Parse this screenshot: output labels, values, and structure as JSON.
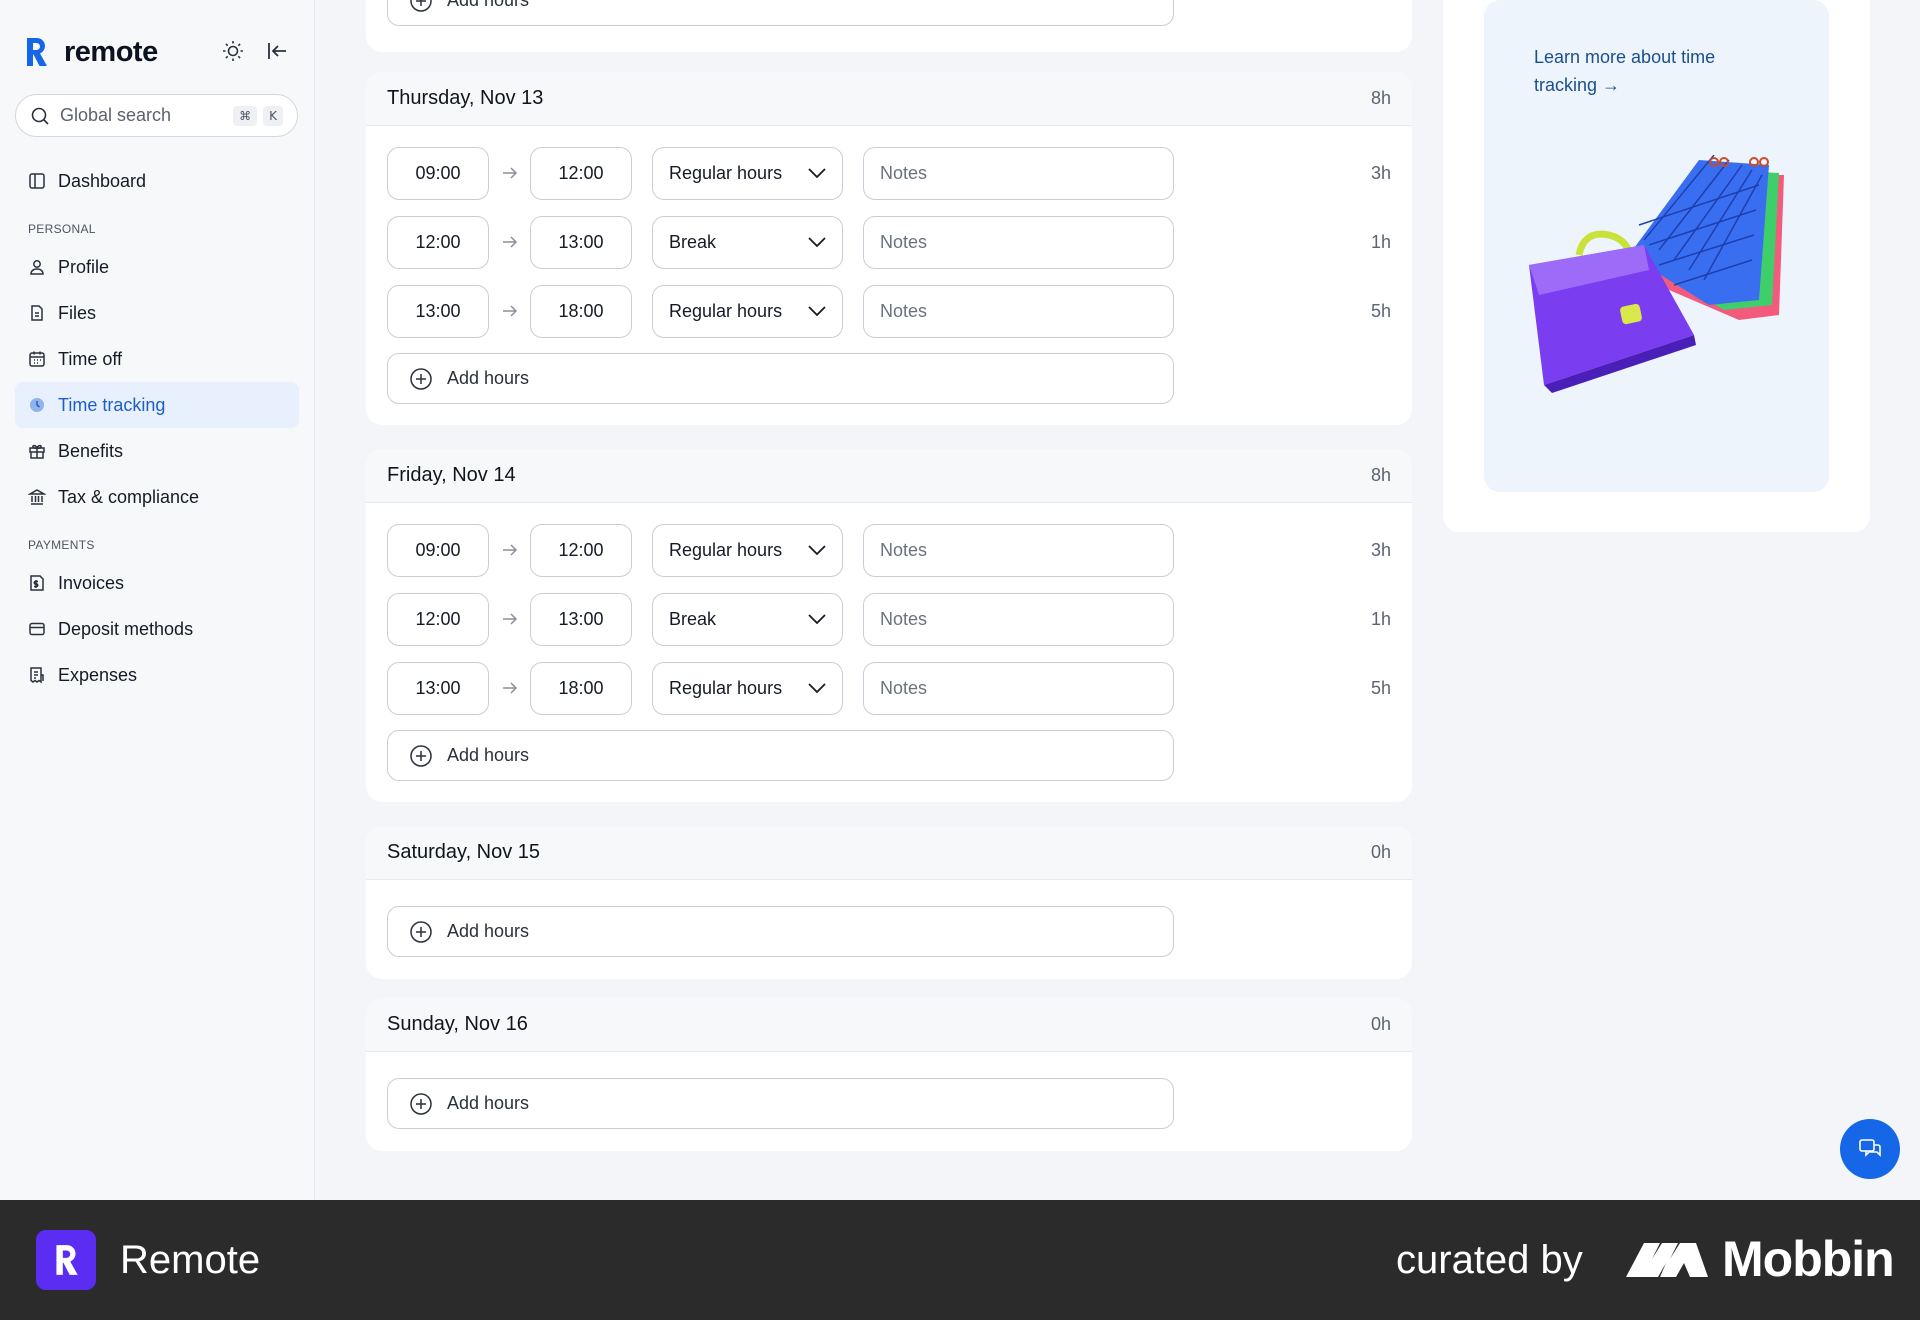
{
  "app": {
    "name": "remote"
  },
  "search": {
    "placeholder": "Global search",
    "kbd_cmd": "⌘",
    "kbd_key": "K"
  },
  "sidebar": {
    "items": [
      {
        "label": "Dashboard"
      },
      {
        "section": "PERSONAL"
      },
      {
        "label": "Profile"
      },
      {
        "label": "Files"
      },
      {
        "label": "Time off"
      },
      {
        "label": "Time tracking",
        "active": true
      },
      {
        "label": "Benefits"
      },
      {
        "label": "Tax & compliance"
      },
      {
        "section": "PAYMENTS"
      },
      {
        "label": "Invoices"
      },
      {
        "label": "Deposit methods"
      },
      {
        "label": "Expenses"
      }
    ]
  },
  "previous_day": {
    "add_hours_label": "Add hours"
  },
  "days": [
    {
      "title": "Thursday, Nov 13",
      "total": "8h",
      "entries": [
        {
          "start": "09:00",
          "end": "12:00",
          "type": "Regular hours",
          "notes": "Notes",
          "duration": "3h"
        },
        {
          "start": "12:00",
          "end": "13:00",
          "type": "Break",
          "notes": "Notes",
          "duration": "1h"
        },
        {
          "start": "13:00",
          "end": "18:00",
          "type": "Regular hours",
          "notes": "Notes",
          "duration": "5h"
        }
      ],
      "add_hours_label": "Add hours"
    },
    {
      "title": "Friday, Nov 14",
      "total": "8h",
      "entries": [
        {
          "start": "09:00",
          "end": "12:00",
          "type": "Regular hours",
          "notes": "Notes",
          "duration": "3h"
        },
        {
          "start": "12:00",
          "end": "13:00",
          "type": "Break",
          "notes": "Notes",
          "duration": "1h"
        },
        {
          "start": "13:00",
          "end": "18:00",
          "type": "Regular hours",
          "notes": "Notes",
          "duration": "5h"
        }
      ],
      "add_hours_label": "Add hours"
    },
    {
      "title": "Saturday, Nov 15",
      "total": "0h",
      "entries": [],
      "add_hours_label": "Add hours"
    },
    {
      "title": "Sunday, Nov 16",
      "total": "0h",
      "entries": [],
      "add_hours_label": "Add hours"
    }
  ],
  "promo": {
    "link_text": "Learn more about time tracking →"
  },
  "footer": {
    "app_name": "Remote",
    "curated_by": "curated by",
    "brand": "Mobbin"
  },
  "colors": {
    "accent": "#1667e8",
    "active_nav_bg": "#e7f0fc",
    "active_nav_text": "#1d5fc7",
    "footer_bg": "#2b2b2c",
    "footer_logo": "#5b2df2"
  }
}
